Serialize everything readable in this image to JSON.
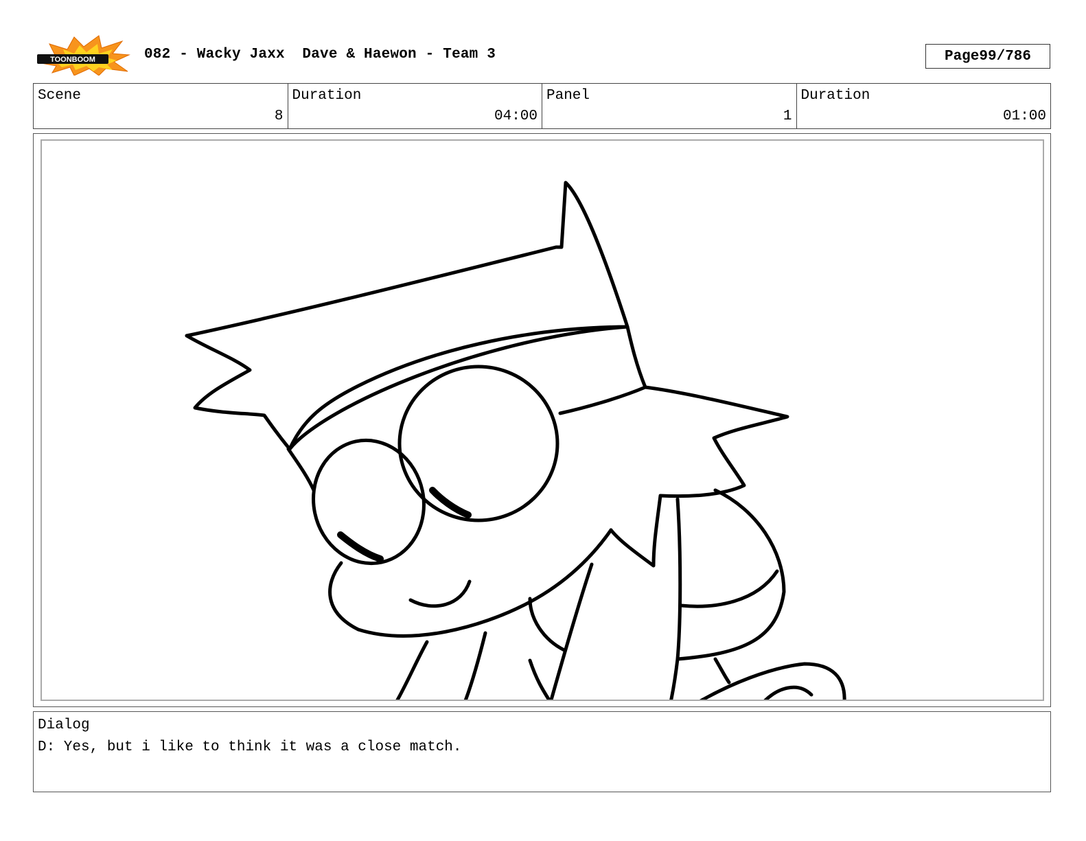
{
  "header": {
    "logo_text": "TOONBOOM",
    "title": "082 - Wacky Jaxx  Dave & Haewon - Team 3",
    "page_label": "Page",
    "page_number": "99/786"
  },
  "info": {
    "scene_label": "Scene",
    "scene_value": "8",
    "scene_duration_label": "Duration",
    "scene_duration_value": "04:00",
    "panel_label": "Panel",
    "panel_value": "1",
    "panel_duration_label": "Duration",
    "panel_duration_value": "01:00"
  },
  "panel": {
    "drawing": "sketch-character-icon"
  },
  "dialog": {
    "label": "Dialog",
    "text": "D: Yes, but i like to think it was a close match."
  }
}
